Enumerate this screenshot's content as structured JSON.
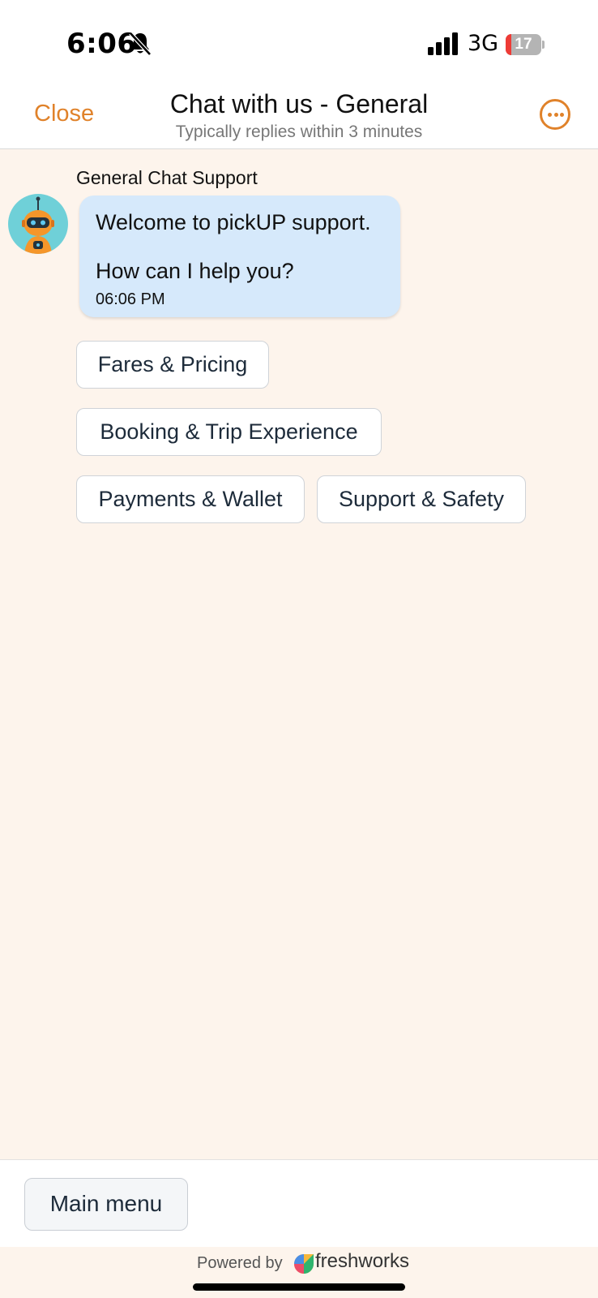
{
  "status_bar": {
    "time": "6:06",
    "network": "3G",
    "battery_level": "17",
    "battery_fraction": 0.17,
    "icons": [
      "bell-slash-icon",
      "signal-icon",
      "battery-icon"
    ]
  },
  "header": {
    "close_label": "Close",
    "title": "Chat with us - General",
    "subtitle": "Typically replies within 3 minutes",
    "more_icon": "more-options-icon"
  },
  "conversation": {
    "sender_name": "General Chat Support",
    "avatar_icon": "robot-avatar-icon",
    "message": {
      "line1": "Welcome to pickUP support.",
      "line2": "How can I help you?",
      "time": "06:06 PM"
    },
    "quick_replies": [
      {
        "label": "Fares & Pricing"
      },
      {
        "label": "Booking & Trip Experience"
      },
      {
        "label": "Payments & Wallet"
      },
      {
        "label": "Support & Safety"
      }
    ]
  },
  "footer": {
    "main_menu_label": "Main menu",
    "powered_by": "Powered by",
    "brand": "freshworks"
  },
  "colors": {
    "accent": "#e0822a",
    "chat_background": "#fdf4ec",
    "bubble": "#d6e9fb",
    "avatar_background": "#6fd0d8"
  }
}
